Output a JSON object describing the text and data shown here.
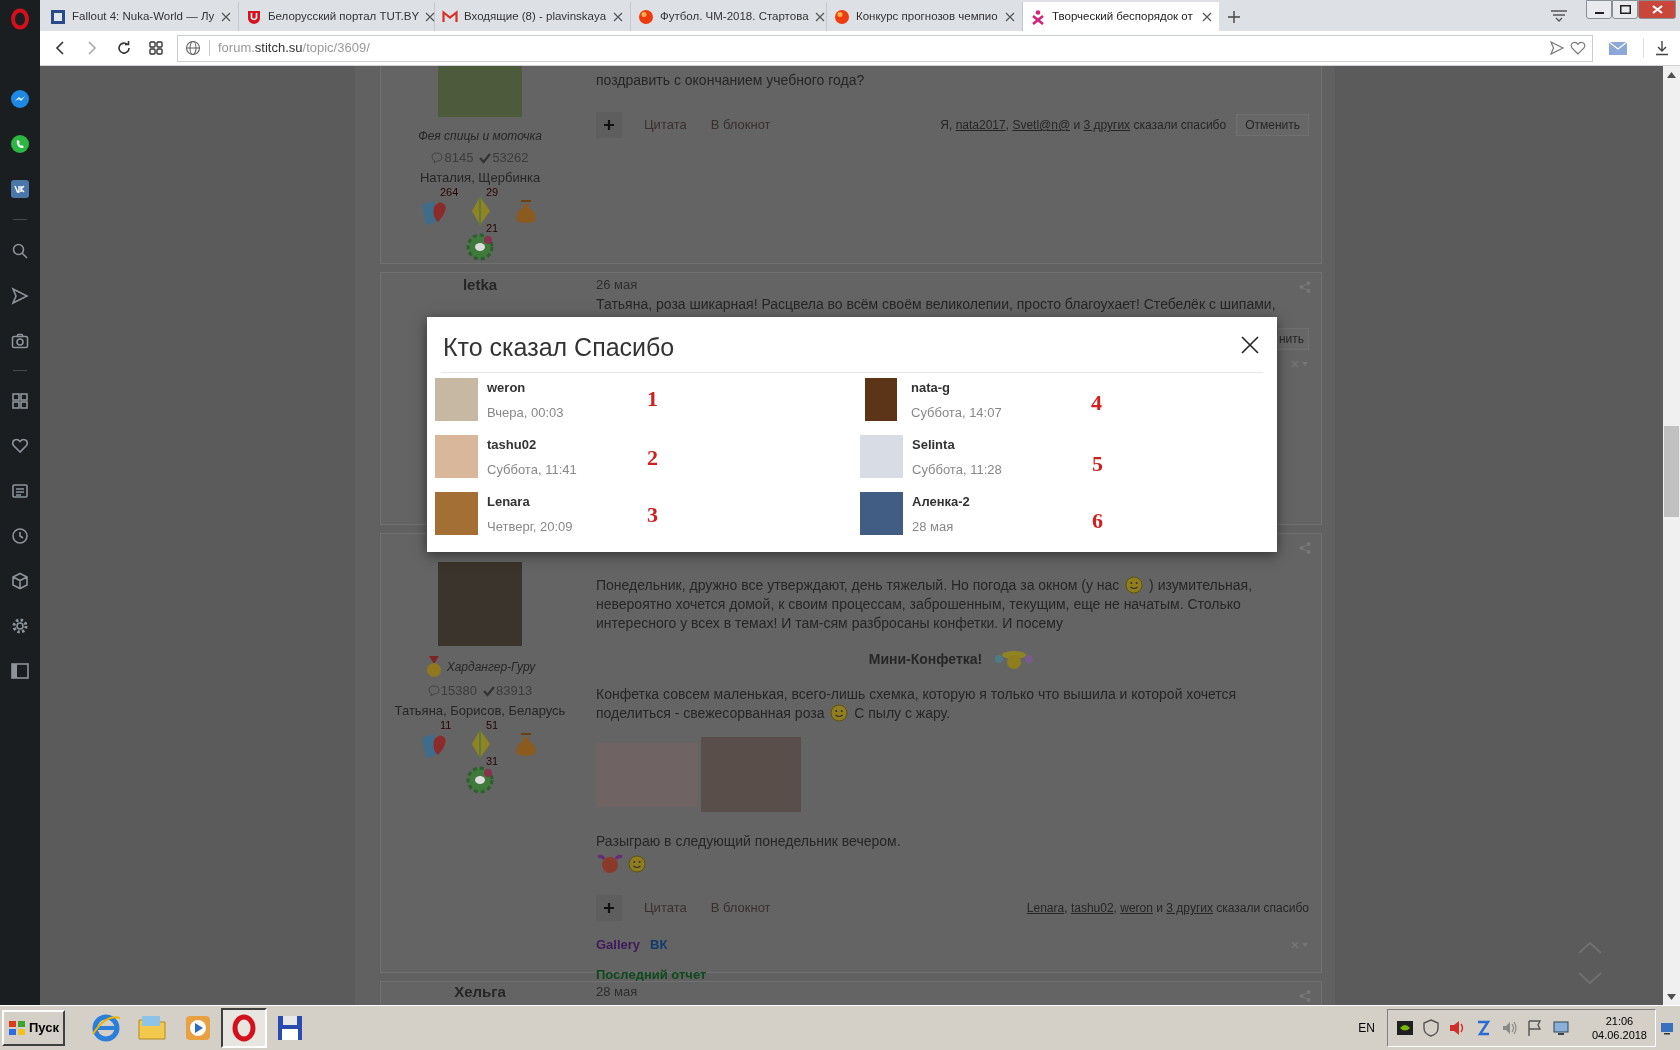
{
  "browser": {
    "tabs": [
      {
        "title": "Fallout 4: Nuka-World — Лу",
        "selected": false
      },
      {
        "title": "Белорусский портал TUT.BY",
        "selected": false
      },
      {
        "title": "Входящие (8) - plavinskaya",
        "selected": false
      },
      {
        "title": "Футбол. ЧМ-2018. Стартова",
        "selected": false
      },
      {
        "title": "Конкурс прогнозов чемпио",
        "selected": false
      },
      {
        "title": "Творческий беспорядок от",
        "selected": true
      }
    ],
    "address_bar": {
      "url_parts": [
        "forum.",
        "stitch.su",
        "/topic/3609/"
      ]
    }
  },
  "posts": [
    {
      "status": "Фея спицы и моточка",
      "messages": "8145",
      "thanks": "53262",
      "location": "Наталия, Щербинка",
      "awards": [
        {
          "kind": "heart",
          "count": "264"
        },
        {
          "kind": "kite",
          "count": "29"
        },
        {
          "kind": "bag"
        },
        {
          "kind": "flower",
          "count": "21"
        }
      ],
      "body": [
        {
          "kind": "text",
          "parts": [
            "поздравить с окончанием учебного года?"
          ]
        }
      ],
      "actions": [
        "Цитата",
        "В блокнот"
      ],
      "thanked_by": [
        {
          "text": "Я, ",
          "link": false
        },
        {
          "text": "nata2017",
          "link": true
        },
        {
          "text": ", ",
          "link": false
        },
        {
          "text": "Svetl@n@",
          "link": true
        },
        {
          "text": " и ",
          "link": false
        },
        {
          "text": "3 других",
          "link": true
        },
        {
          "text": " сказали спасибо",
          "link": false
        }
      ],
      "cancel": "Отменить"
    },
    {
      "author": "letka",
      "date": "26 мая",
      "body": [
        {
          "kind": "text",
          "parts": [
            "Татьяна, роза шикарная! Расцвела во всём своём великолепии, просто благоухает! Стебелёк с  шипами,"
          ]
        }
      ],
      "cancel": "нить"
    },
    {
      "medal": true,
      "status": "Хардангер-Гуру",
      "messages": "15380",
      "thanks": "83913",
      "location": "Татьяна, Борисов, Беларусь",
      "awards": [
        {
          "kind": "heart",
          "count": "11"
        },
        {
          "kind": "kite",
          "count": "51"
        },
        {
          "kind": "bag"
        },
        {
          "kind": "flower",
          "count": "31"
        }
      ],
      "body": [
        {
          "kind": "text",
          "parts": [
            "Понедельник, дружно все утверждают, день тяжелый. Но погода за окном (у нас ",
            " ) изумительная, невероятно хочется домой, к своим процессам, заброшенным, текущим, еще не начатым. Столько интересного у всех в темах! И там-сям разбросаны конфетки. И посему"
          ]
        },
        {
          "kind": "heading",
          "text": "Мини-Конфетка!"
        },
        {
          "kind": "text",
          "parts": [
            "Конфетка совсем маленькая, всего-лишь схемка, которую я только что вышила и которой хочется поделиться - свежесорванная роза ",
            " С пылу с жару."
          ]
        },
        {
          "kind": "photos"
        },
        {
          "kind": "text",
          "parts": [
            "Разыграю в следующий понедельник вечером."
          ]
        },
        {
          "kind": "smileys"
        }
      ],
      "actions": [
        "Цитата",
        "В блокнот"
      ],
      "thanked_by": [
        {
          "text": "Lenara",
          "link": true
        },
        {
          "text": ", ",
          "link": false
        },
        {
          "text": "tashu02",
          "link": true
        },
        {
          "text": ", ",
          "link": false
        },
        {
          "text": "weron",
          "link": true
        },
        {
          "text": " и ",
          "link": false
        },
        {
          "text": "3 других",
          "link": true
        },
        {
          "text": " сказали спасибо",
          "link": false
        }
      ],
      "signature_lines": [
        {
          "items": [
            {
              "text": "Gallery",
              "color": "#3e1a5c"
            },
            {
              "text": "ВК",
              "color": "#123a6e"
            }
          ]
        },
        {
          "items": [
            {
              "text": "Последний отчет",
              "color": "#0f4a1e"
            }
          ]
        }
      ]
    },
    {
      "author": "Хельга",
      "date": "28 мая"
    }
  ],
  "dialog": {
    "title": "Кто сказал Спасибо",
    "users": [
      {
        "name": "weron",
        "time": "Вчера, 00:03",
        "annotation": "1"
      },
      {
        "name": "tashu02",
        "time": "Суббота, 11:41",
        "annotation": "2"
      },
      {
        "name": "Lenara",
        "time": "Четверг, 20:09",
        "annotation": "3"
      },
      {
        "name": "nata-g",
        "time": "Суббота, 14:07",
        "annotation": "4"
      },
      {
        "name": "Selinta",
        "time": "Суббота, 11:28",
        "annotation": "5"
      },
      {
        "name": "Аленка-2",
        "time": "28 мая",
        "annotation": "6"
      }
    ]
  },
  "taskbar": {
    "start": "Пуск",
    "language": "EN",
    "time": "21:06",
    "date": "04.06.2018"
  }
}
